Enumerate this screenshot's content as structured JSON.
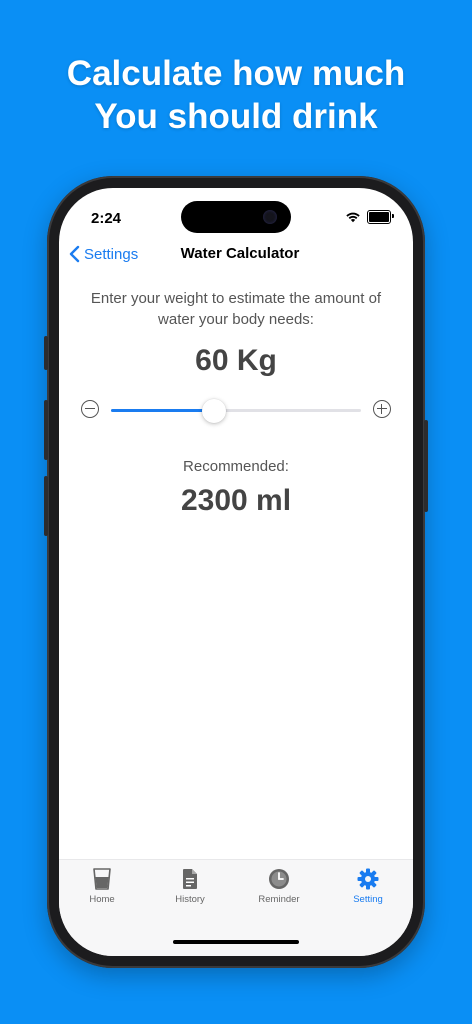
{
  "headline": {
    "line1": "Calculate how much",
    "line2": "You should drink"
  },
  "status": {
    "time": "2:24"
  },
  "nav": {
    "back_label": "Settings",
    "title": "Water Calculator"
  },
  "calculator": {
    "prompt": "Enter your weight to estimate the amount of water your body needs:",
    "weight_value": "60 Kg",
    "slider_fraction": 0.41,
    "recommended_label": "Recommended:",
    "recommended_value": "2300 ml"
  },
  "tabs": [
    {
      "label": "Home",
      "icon": "glass-icon",
      "active": false
    },
    {
      "label": "History",
      "icon": "document-icon",
      "active": false
    },
    {
      "label": "Reminder",
      "icon": "clock-icon",
      "active": false
    },
    {
      "label": "Setting",
      "icon": "gear-icon",
      "active": true
    }
  ],
  "colors": {
    "background": "#0a8ff5",
    "accent": "#1a7cf0",
    "text": "#444444"
  }
}
